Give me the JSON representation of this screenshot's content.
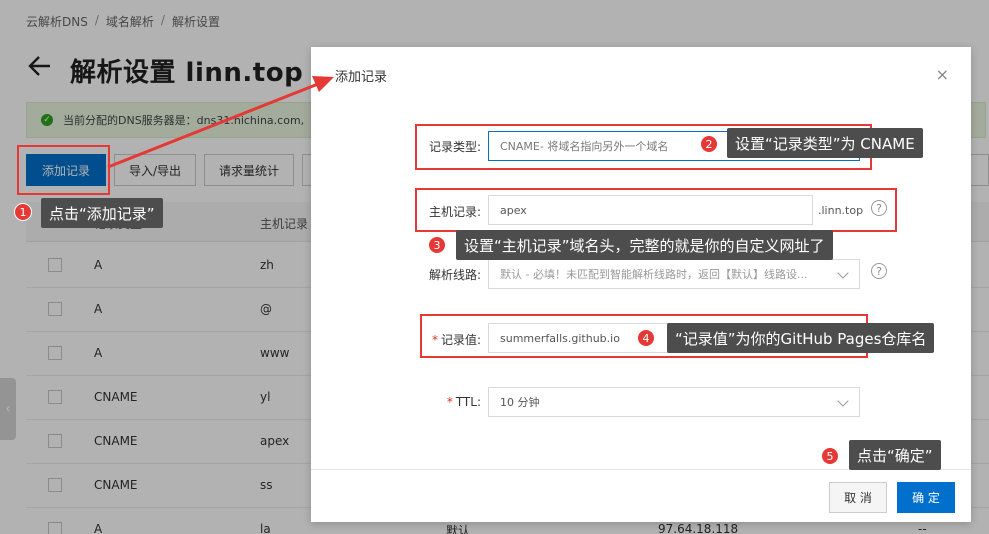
{
  "breadcrumb": [
    "云解析DNS",
    "域名解析",
    "解析设置"
  ],
  "page_title": "解析设置 linn.top",
  "dns_notice": "当前分配的DNS服务器是：dns31.hichina.com,",
  "toolbar": {
    "add": "添加记录",
    "import_export": "导入/导出",
    "stats": "请求量统计"
  },
  "table": {
    "headers": [
      "记录类型",
      "主机记录"
    ],
    "rows": [
      {
        "type": "A",
        "host": "zh"
      },
      {
        "type": "A",
        "host": "@"
      },
      {
        "type": "A",
        "host": "www"
      },
      {
        "type": "CNAME",
        "host": "yl"
      },
      {
        "type": "CNAME",
        "host": "apex"
      },
      {
        "type": "CNAME",
        "host": "ss"
      },
      {
        "type": "A",
        "host": "la",
        "line": "默认",
        "value": "97.64.18.118",
        "extra": "--"
      }
    ]
  },
  "modal": {
    "title": "添加记录",
    "close": "×",
    "record_type_label": "记录类型:",
    "record_type_value": "CNAME- 将域名指向另外一个域名",
    "host_label": "主机记录:",
    "host_value": "apex",
    "host_suffix": ".linn.top",
    "line_label": "解析线路:",
    "line_value": "默认 - 必填！未匹配到智能解析线路时，返回【默认】线路设...",
    "value_label": "记录值:",
    "value_value": "summerfalls.github.io",
    "ttl_label": "TTL:",
    "ttl_value": "10 分钟",
    "required_mark": "*",
    "help": "?",
    "cancel": "取 消",
    "ok": "确 定"
  },
  "annotations": [
    {
      "num": "1",
      "text": "点击“添加记录”"
    },
    {
      "num": "2",
      "text": "设置“记录类型”为 CNAME"
    },
    {
      "num": "3",
      "text": "设置“主机记录”域名头，完整的就是你的自定义网址了"
    },
    {
      "num": "4",
      "text": "“记录值”为你的GitHub Pages仓库名"
    },
    {
      "num": "5",
      "text": "点击“确定”"
    }
  ],
  "colors": {
    "primary": "#0070cc",
    "annotation_red": "#e53935",
    "tooltip_bg": "#4d4d4d"
  }
}
